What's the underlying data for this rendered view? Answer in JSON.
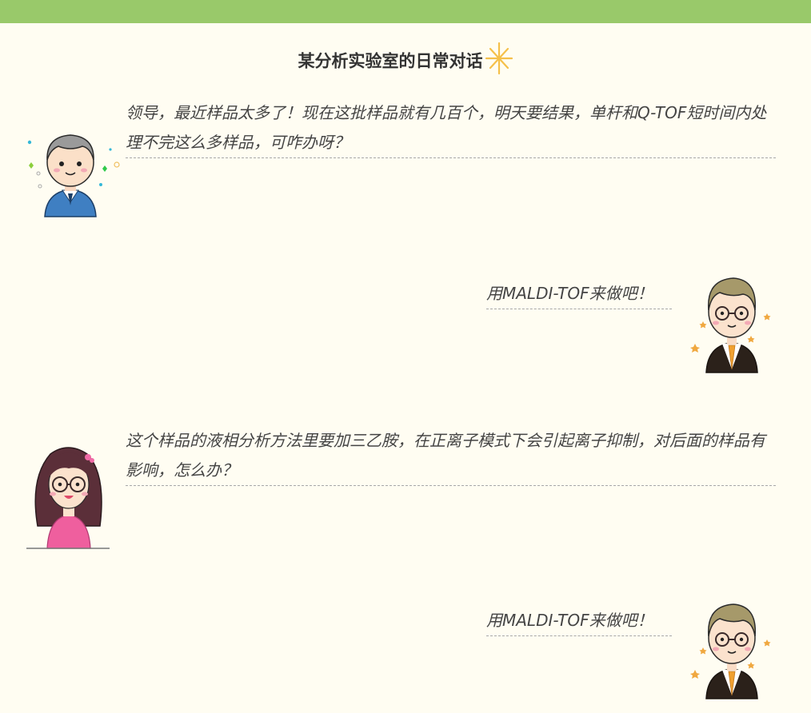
{
  "colors": {
    "top_bar": "#99c96a",
    "background": "#fffdf2",
    "text": "#444444",
    "title": "#333333",
    "sparkle": "#f5c04a"
  },
  "header": {
    "title": "某分析实验室的日常对话",
    "sparkle_icon": "sparkle-icon"
  },
  "dialogue": [
    {
      "speaker_icon": "boss-avatar-icon",
      "text": "领导，最近样品太多了！现在这批样品就有几百个，明天要结果，单杆和Q-TOF短时间内处理不完这么多样品，可咋办呀？"
    },
    {
      "speaker_icon": "expert-avatar-icon",
      "text": "用MALDI-TOF来做吧！"
    },
    {
      "speaker_icon": "girl-avatar-icon",
      "text": "这个样品的液相分析方法里要加三乙胺，在正离子模式下会引起离子抑制，对后面的样品有影响，怎么办？"
    },
    {
      "speaker_icon": "expert-avatar-icon",
      "text": "用MALDI-TOF来做吧！"
    }
  ]
}
